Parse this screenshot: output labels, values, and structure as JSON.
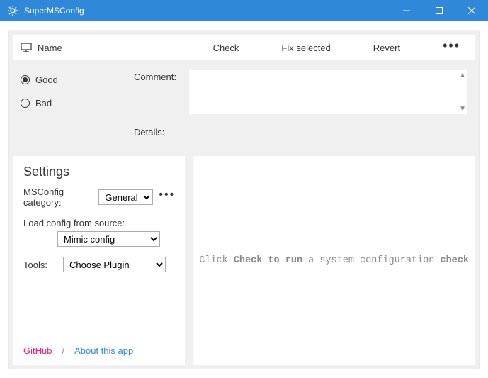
{
  "window": {
    "title": "SuperMSConfig"
  },
  "header": {
    "name_col": "Name",
    "check": "Check",
    "fix": "Fix selected",
    "revert": "Revert"
  },
  "status": {
    "good": "Good",
    "bad": "Bad",
    "selected": "good"
  },
  "labels": {
    "comment": "Comment:",
    "details": "Details:"
  },
  "settings": {
    "title": "Settings",
    "category_label": "MSConfig category:",
    "category_value": "General",
    "load_label": "Load config from source:",
    "load_value": "Mimic config",
    "tools_label": "Tools:",
    "tools_value": "Choose Plugin"
  },
  "links": {
    "github": "GitHub",
    "sep": "/",
    "about": "About this app"
  },
  "output": {
    "p1": "Click ",
    "b1": "Check to run",
    "p2": " a system configuration ",
    "b2": "check"
  }
}
